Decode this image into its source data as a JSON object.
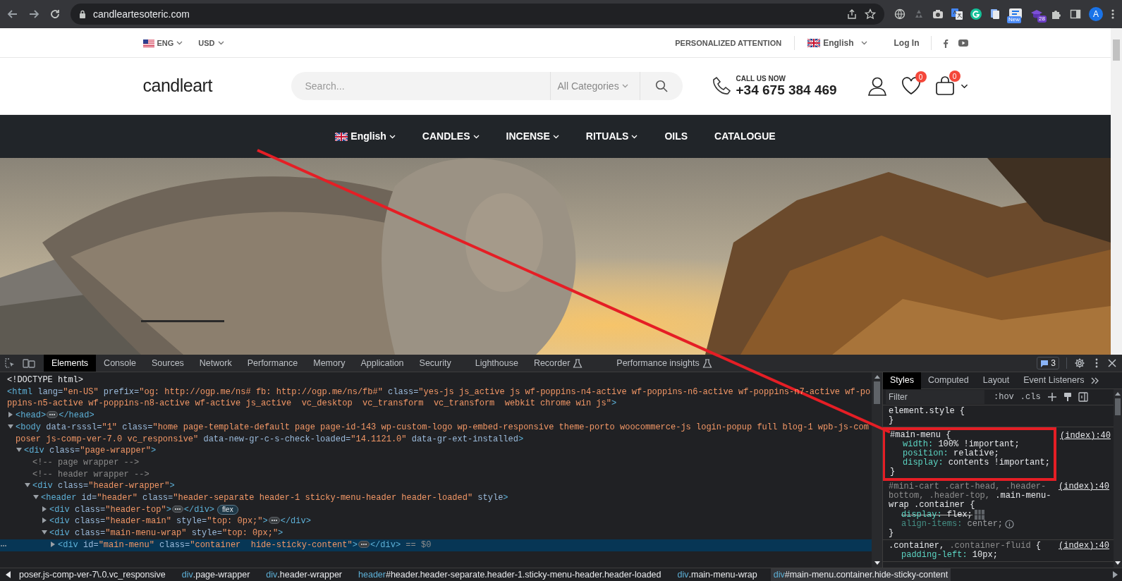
{
  "browser": {
    "url": "candleartesoteric.com",
    "new_badge": "New",
    "count_badge": "28",
    "profile_initial": "A"
  },
  "site": {
    "topbar": {
      "language": "ENG",
      "currency": "USD",
      "attention": "PERSONALIZED ATTENTION",
      "site_language": "English",
      "login": "Log In"
    },
    "header": {
      "logo": "candleart",
      "search_placeholder": "Search...",
      "category": "All Categories",
      "call_label": "CALL US NOW",
      "phone": "+34 675 384 469",
      "wishlist_count": "0",
      "cart_count": "0"
    },
    "nav": [
      {
        "label": "English",
        "flag": true,
        "submenu": true
      },
      {
        "label": "CANDLES",
        "flag": false,
        "submenu": true
      },
      {
        "label": "INCENSE",
        "flag": false,
        "submenu": true
      },
      {
        "label": "RITUALS",
        "flag": false,
        "submenu": true
      },
      {
        "label": "OILS",
        "flag": false,
        "submenu": false
      },
      {
        "label": "CATALOGUE",
        "flag": false,
        "submenu": false
      }
    ]
  },
  "devtools": {
    "tabs": [
      {
        "label": "Elements",
        "selected": true,
        "experimental": false
      },
      {
        "label": "Console",
        "selected": false,
        "experimental": false
      },
      {
        "label": "Sources",
        "selected": false,
        "experimental": false
      },
      {
        "label": "Network",
        "selected": false,
        "experimental": false
      },
      {
        "label": "Performance",
        "selected": false,
        "experimental": false
      },
      {
        "label": "Memory",
        "selected": false,
        "experimental": false
      },
      {
        "label": "Application",
        "selected": false,
        "experimental": false
      },
      {
        "label": "Security",
        "selected": false,
        "experimental": false
      },
      {
        "label": "Lighthouse",
        "selected": false,
        "experimental": false
      },
      {
        "label": "Recorder",
        "selected": false,
        "experimental": true
      },
      {
        "label": "Performance insights",
        "selected": false,
        "experimental": true
      }
    ],
    "issues_count": "3",
    "dom": [
      {
        "selected": false,
        "tokens": [
          {
            "kind": "plain",
            "text": "<!DOCTYPE html>"
          }
        ]
      },
      {
        "selected": false,
        "tokens": [
          {
            "kind": "tag",
            "text": "<html"
          },
          {
            "kind": "attr",
            "text": " lang="
          },
          {
            "kind": "value",
            "text": "\"en-US\""
          },
          {
            "kind": "attr",
            "text": " prefix="
          },
          {
            "kind": "value",
            "text": "\"og: http://ogp.me/ns# fb: http://ogp.me/ns/fb#\""
          },
          {
            "kind": "attr",
            "text": " class="
          },
          {
            "kind": "value",
            "text": "\"yes-js js_active js wf-poppins-n4-active wf-poppins-n6-active wf-poppins-n7-active wf-poppins-n5-active wf-poppins-n8-active wf-active js_active  vc_desktop  vc_transform  vc_transform  webkit chrome win js\""
          },
          {
            "kind": "tag",
            "text": ">"
          }
        ],
        "children": [
          {
            "expanded": false,
            "selected": false,
            "tokens": [
              {
                "kind": "tag",
                "text": "<head>"
              },
              {
                "kind": "ellipsis"
              },
              {
                "kind": "tag",
                "text": "</head>"
              }
            ]
          },
          {
            "expanded": true,
            "selected": false,
            "tokens": [
              {
                "kind": "tag",
                "text": "<body"
              },
              {
                "kind": "attr",
                "text": " data-rsssl="
              },
              {
                "kind": "value",
                "text": "\"1\""
              },
              {
                "kind": "attr",
                "text": " class="
              },
              {
                "kind": "value",
                "text": "\"home page-template-default page page-id-143 wp-custom-logo wp-embed-responsive theme-porto woocommerce-js login-popup full blog-1 wpb-js-composer js-comp-ver-7.0 vc_responsive\""
              },
              {
                "kind": "attr",
                "text": " data-new-gr-c-s-check-loaded="
              },
              {
                "kind": "value",
                "text": "\"14.1121.0\""
              },
              {
                "kind": "attr",
                "text": " data-gr-ext-installed"
              },
              {
                "kind": "tag",
                "text": ">"
              }
            ],
            "children": [
              {
                "expanded": true,
                "selected": false,
                "tokens": [
                  {
                    "kind": "tag",
                    "text": "<div"
                  },
                  {
                    "kind": "attr",
                    "text": " class="
                  },
                  {
                    "kind": "value",
                    "text": "\"page-wrapper\""
                  },
                  {
                    "kind": "tag",
                    "text": ">"
                  }
                ],
                "children": [
                  {
                    "selected": false,
                    "tokens": [
                      {
                        "kind": "comment",
                        "text": "<!-- page wrapper -->"
                      }
                    ]
                  },
                  {
                    "selected": false,
                    "tokens": [
                      {
                        "kind": "comment",
                        "text": "<!-- header wrapper -->"
                      }
                    ]
                  },
                  {
                    "expanded": true,
                    "selected": false,
                    "tokens": [
                      {
                        "kind": "tag",
                        "text": "<div"
                      },
                      {
                        "kind": "attr",
                        "text": " class="
                      },
                      {
                        "kind": "value",
                        "text": "\"header-wrapper\""
                      },
                      {
                        "kind": "tag",
                        "text": ">"
                      }
                    ],
                    "children": [
                      {
                        "expanded": true,
                        "selected": false,
                        "tokens": [
                          {
                            "kind": "tag",
                            "text": "<header"
                          },
                          {
                            "kind": "attr",
                            "text": " id="
                          },
                          {
                            "kind": "value",
                            "text": "\"header\""
                          },
                          {
                            "kind": "attr",
                            "text": " class="
                          },
                          {
                            "kind": "value",
                            "text": "\"header-separate header-1 sticky-menu-header header-loaded\""
                          },
                          {
                            "kind": "attr",
                            "text": " style"
                          },
                          {
                            "kind": "tag",
                            "text": ">"
                          }
                        ],
                        "children": [
                          {
                            "expanded": false,
                            "selected": false,
                            "tokens": [
                              {
                                "kind": "tag",
                                "text": "<div"
                              },
                              {
                                "kind": "attr",
                                "text": " class="
                              },
                              {
                                "kind": "value",
                                "text": "\"header-top\""
                              },
                              {
                                "kind": "tag",
                                "text": ">"
                              },
                              {
                                "kind": "ellipsis"
                              },
                              {
                                "kind": "tag",
                                "text": "</div>"
                              },
                              {
                                "kind": "badge",
                                "text": "flex"
                              }
                            ]
                          },
                          {
                            "expanded": false,
                            "selected": false,
                            "tokens": [
                              {
                                "kind": "tag",
                                "text": "<div"
                              },
                              {
                                "kind": "attr",
                                "text": " class="
                              },
                              {
                                "kind": "value",
                                "text": "\"header-main\""
                              },
                              {
                                "kind": "attr",
                                "text": " style="
                              },
                              {
                                "kind": "value",
                                "text": "\"top: 0px;\""
                              },
                              {
                                "kind": "tag",
                                "text": ">"
                              },
                              {
                                "kind": "ellipsis"
                              },
                              {
                                "kind": "tag",
                                "text": "</div>"
                              }
                            ]
                          },
                          {
                            "expanded": true,
                            "selected": false,
                            "tokens": [
                              {
                                "kind": "tag",
                                "text": "<div"
                              },
                              {
                                "kind": "attr",
                                "text": " class="
                              },
                              {
                                "kind": "value",
                                "text": "\"main-menu-wrap\""
                              },
                              {
                                "kind": "attr",
                                "text": " style="
                              },
                              {
                                "kind": "value",
                                "text": "\"top: 0px;\""
                              },
                              {
                                "kind": "tag",
                                "text": ">"
                              }
                            ],
                            "children": [
                              {
                                "expanded": false,
                                "selected": true,
                                "tokens": [
                                  {
                                    "kind": "tag",
                                    "text": "<div"
                                  },
                                  {
                                    "kind": "attr",
                                    "text": " id="
                                  },
                                  {
                                    "kind": "value",
                                    "text": "\"main-menu\""
                                  },
                                  {
                                    "kind": "attr",
                                    "text": " class="
                                  },
                                  {
                                    "kind": "value",
                                    "text": "\"container  hide-sticky-content\""
                                  },
                                  {
                                    "kind": "tag",
                                    "text": ">"
                                  },
                                  {
                                    "kind": "ellipsis"
                                  },
                                  {
                                    "kind": "tag",
                                    "text": "</div>"
                                  },
                                  {
                                    "kind": "ref",
                                    "text": " == $0"
                                  }
                                ]
                              }
                            ]
                          }
                        ]
                      }
                    ]
                  }
                ]
              }
            ]
          }
        ]
      }
    ],
    "breadcrumbs": [
      {
        "rest": "poser.js-comp-ver-7\\.0.vc_responsive",
        "selected": false
      },
      {
        "tag": "div",
        "rest": ".page-wrapper",
        "selected": false
      },
      {
        "tag": "div",
        "rest": ".header-wrapper",
        "selected": false
      },
      {
        "tag": "header",
        "rest": "#header.header-separate.header-1.sticky-menu-header.header-loaded",
        "selected": false
      },
      {
        "tag": "div",
        "rest": ".main-menu-wrap",
        "selected": false
      },
      {
        "tag": "div",
        "rest": "#main-menu.container.hide-sticky-content",
        "selected": true
      }
    ],
    "styles": {
      "tabs": [
        {
          "label": "Styles",
          "selected": true
        },
        {
          "label": "Computed",
          "selected": false
        },
        {
          "label": "Layout",
          "selected": false
        },
        {
          "label": "Event Listeners",
          "selected": false
        }
      ],
      "filter_placeholder": "Filter",
      "hov": ":hov",
      "cls": ".cls",
      "rules": [
        {
          "selector": [
            {
              "text": "element.style",
              "matched": true
            }
          ],
          "open": "{",
          "close": "}",
          "highlighted": false
        },
        {
          "selector": [
            {
              "text": "#main-menu",
              "matched": true
            }
          ],
          "open": "{",
          "close": "}",
          "source": "(index):40",
          "highlighted": true,
          "properties": [
            {
              "name": "width:",
              "value": "100% !important;",
              "struck": false,
              "inactive": false
            },
            {
              "name": "position:",
              "value": "relative;",
              "struck": false,
              "inactive": false
            },
            {
              "name": "display:",
              "value": "contents !important;",
              "struck": false,
              "inactive": false
            }
          ]
        },
        {
          "selector": [
            {
              "text": "#mini-cart .cart-head, .header-bottom, .header-top, ",
              "matched": false
            },
            {
              "text": ".main-menu-wrap .container",
              "matched": true
            }
          ],
          "open": "{",
          "close": "}",
          "source": "(index):40",
          "highlighted": false,
          "properties": [
            {
              "name": "display:",
              "value": "flex;",
              "struck": true,
              "inactive": false
            },
            {
              "name": "align-items:",
              "value": "center;",
              "struck": false,
              "inactive": true
            }
          ]
        },
        {
          "selector": [
            {
              "text": ".container, ",
              "matched": true
            },
            {
              "text": ".container-fluid",
              "matched": false
            }
          ],
          "open": "{",
          "source": "(index):40",
          "highlighted": false,
          "properties": [
            {
              "name": "padding-left:",
              "value": "10px;",
              "struck": false,
              "inactive": false
            }
          ]
        }
      ]
    }
  }
}
